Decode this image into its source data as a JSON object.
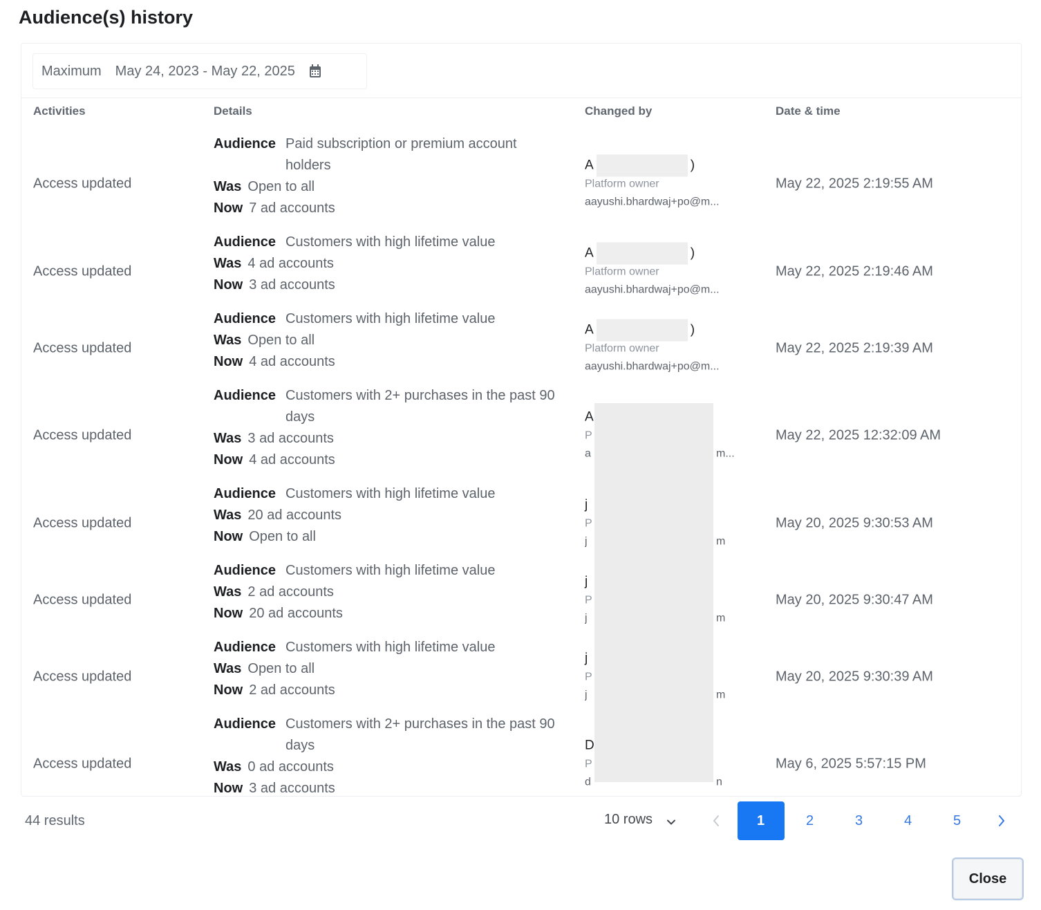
{
  "dialog": {
    "title": "Audience(s) history"
  },
  "filter": {
    "preset": "Maximum",
    "range": "May 24, 2023 - May 22, 2025",
    "icon": "calendar-icon"
  },
  "table": {
    "headers": {
      "activities": "Activities",
      "details": "Details",
      "changed_by": "Changed by",
      "date_time": "Date & time"
    },
    "labels": {
      "audience": "Audience",
      "was": "Was",
      "now": "Now"
    },
    "rows": [
      {
        "activity": "Access updated",
        "audience": "Paid subscription or premium account holders",
        "was": "Open to all",
        "now": "7 ad accounts",
        "changed_by_name_start": "A",
        "changed_by_name_end": ")",
        "changed_by_role": "Platform owner",
        "changed_by_email": "aayushi.bhardwaj+po@m...",
        "date": "May 22, 2025 2:19:55 AM"
      },
      {
        "activity": "Access updated",
        "audience": "Customers with high lifetime value",
        "was": "4 ad accounts",
        "now": "3 ad accounts",
        "changed_by_name_start": "A",
        "changed_by_name_end": ")",
        "changed_by_role": "Platform owner",
        "changed_by_email": "aayushi.bhardwaj+po@m...",
        "date": "May 22, 2025 2:19:46 AM"
      },
      {
        "activity": "Access updated",
        "audience": "Customers with high lifetime value",
        "was": "Open to all",
        "now": "4 ad accounts",
        "changed_by_name_start": "A",
        "changed_by_name_end": ")",
        "changed_by_role": "Platform owner",
        "changed_by_email": "aayushi.bhardwaj+po@m...",
        "date": "May 22, 2025 2:19:39 AM"
      },
      {
        "activity": "Access updated",
        "audience": "Customers with 2+ purchases in the past 90 days",
        "was": "3 ad accounts",
        "now": "4 ad accounts",
        "changed_by_name_start": "A",
        "changed_by_name_end": "",
        "changed_by_role": "P",
        "changed_by_email": "a",
        "changed_by_tail": "m...",
        "date": "May 22, 2025 12:32:09 AM"
      },
      {
        "activity": "Access updated",
        "audience": "Customers with high lifetime value",
        "was": "20 ad accounts",
        "now": "Open to all",
        "changed_by_name_start": "j",
        "changed_by_name_end": "",
        "changed_by_role": "P",
        "changed_by_email": "j",
        "changed_by_tail": "m",
        "date": "May 20, 2025 9:30:53 AM"
      },
      {
        "activity": "Access updated",
        "audience": "Customers with high lifetime value",
        "was": "2 ad accounts",
        "now": "20 ad accounts",
        "changed_by_name_start": "j",
        "changed_by_name_end": "",
        "changed_by_role": "P",
        "changed_by_email": "j",
        "changed_by_tail": "m",
        "date": "May 20, 2025 9:30:47 AM"
      },
      {
        "activity": "Access updated",
        "audience": "Customers with high lifetime value",
        "was": "Open to all",
        "now": "2 ad accounts",
        "changed_by_name_start": "j",
        "changed_by_name_end": "",
        "changed_by_role": "P",
        "changed_by_email": "j",
        "changed_by_tail": "m",
        "date": "May 20, 2025 9:30:39 AM"
      },
      {
        "activity": "Access updated",
        "audience": "Customers with 2+ purchases in the past 90 days",
        "was": "0 ad accounts",
        "now": "3 ad accounts",
        "changed_by_name_start": "D",
        "changed_by_name_end": "",
        "changed_by_role": "P",
        "changed_by_email": "d",
        "changed_by_tail": "n",
        "date": "May 6, 2025 5:57:15 PM"
      }
    ]
  },
  "footer": {
    "results": "44 results",
    "rows_per_page": "10 rows",
    "pages": [
      "1",
      "2",
      "3",
      "4",
      "5"
    ],
    "current_page": "1"
  },
  "actions": {
    "close": "Close"
  },
  "colors": {
    "accent": "#1877f2",
    "link": "#3578e5"
  }
}
